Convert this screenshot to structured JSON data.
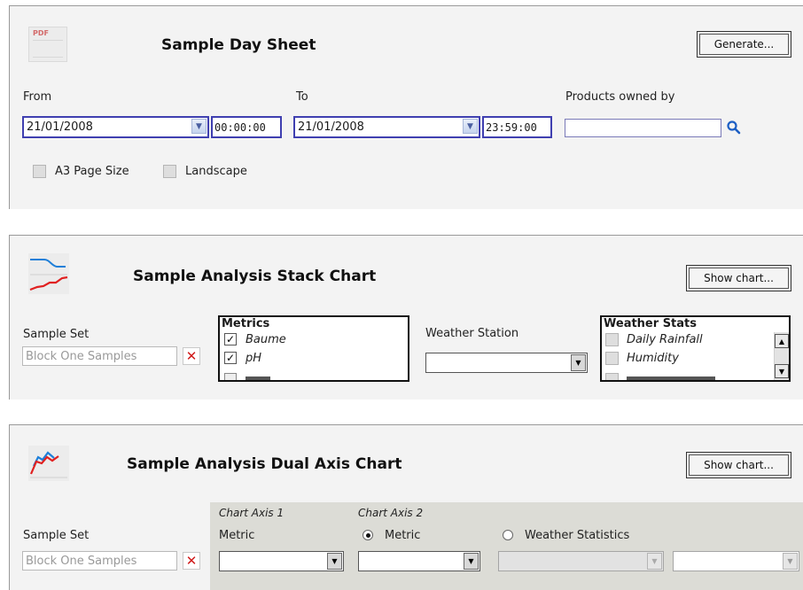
{
  "day_sheet": {
    "icon_label": "PDF",
    "title": "Sample Day Sheet",
    "generate_label": "Generate...",
    "from_label": "From",
    "to_label": "To",
    "products_label": "Products owned by",
    "from_date": "21/01/2008",
    "from_time": "00:00:00",
    "to_date": "21/01/2008",
    "to_time": "23:59:00",
    "products_value": "",
    "a3_label": "A3 Page Size",
    "landscape_label": "Landscape"
  },
  "stack_chart": {
    "title": "Sample Analysis Stack Chart",
    "show_label": "Show chart...",
    "sample_set_label": "Sample Set",
    "sample_set_placeholder": "Block One Samples",
    "metrics_header": "Metrics",
    "metrics": [
      {
        "label": "Baume",
        "checked": true
      },
      {
        "label": "pH",
        "checked": true
      }
    ],
    "weather_station_label": "Weather Station",
    "weather_station_value": "",
    "weather_stats_header": "Weather Stats",
    "weather_stats": [
      {
        "label": "Daily Rainfall",
        "checked": false
      },
      {
        "label": "Humidity",
        "checked": false
      }
    ]
  },
  "dual_axis": {
    "title": "Sample Analysis Dual Axis Chart",
    "show_label": "Show chart...",
    "sample_set_label": "Sample Set",
    "sample_set_placeholder": "Block One Samples",
    "axis1_label": "Chart Axis 1",
    "axis1_metric_label": "Metric",
    "axis2_label": "Chart Axis 2",
    "axis2_metric_option": "Metric",
    "axis2_weather_option": "Weather Statistics",
    "axis2_selected": "Metric"
  },
  "colors": {
    "panel_bg": "#f3f3f3",
    "axis_bg": "#dcdcd6",
    "focus_border": "#3f3fb0",
    "chart_icon_red": "#e02020",
    "chart_icon_blue": "#1e7fd8"
  }
}
